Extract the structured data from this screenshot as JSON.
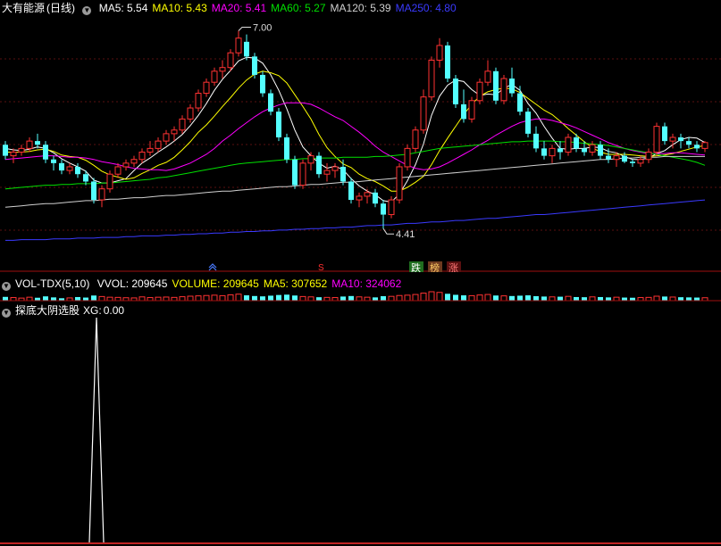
{
  "price_panel": {
    "stock_name": "大有能源",
    "period": "(日线)",
    "ma_labels": [
      {
        "label": "MA5:",
        "value": "5.54",
        "color": "#ffffff"
      },
      {
        "label": "MA10:",
        "value": "5.43",
        "color": "#ffff00"
      },
      {
        "label": "MA20:",
        "value": "5.41",
        "color": "#ff00ff"
      },
      {
        "label": "MA60:",
        "value": "5.27",
        "color": "#00e000"
      },
      {
        "label": "MA120:",
        "value": "5.39",
        "color": "#d0d0d0"
      },
      {
        "label": "MA250:",
        "value": "4.80",
        "color": "#3a3aff"
      }
    ],
    "high_marker": "7.00",
    "low_marker": "4.41",
    "event_tags": [
      {
        "text": "跌",
        "bg": "#1f6e1f",
        "color": "#ffffff"
      },
      {
        "text": "榜",
        "bg": "#6e3a1f",
        "color": "#ffcc66"
      },
      {
        "text": "涨",
        "bg": "#5a1010",
        "color": "#ff7777"
      }
    ],
    "marker_s": "S"
  },
  "volume_panel": {
    "indicator": "VOL-TDX(5,10)",
    "items": [
      {
        "label": "VVOL:",
        "value": "209645",
        "color": "#ffffff"
      },
      {
        "label": "VOLUME:",
        "value": "209645",
        "color": "#ffff00"
      },
      {
        "label": "MA5:",
        "value": "307652",
        "color": "#ffff00"
      },
      {
        "label": "MA10:",
        "value": "324062",
        "color": "#ff00ff"
      }
    ]
  },
  "signal_panel": {
    "indicator": "探底大阴选股",
    "xg_label": "XG:",
    "xg_value": "0.00"
  },
  "chart_data": {
    "type": "candlestick",
    "ylim": [
      4.0,
      7.3
    ],
    "candles": [
      [
        5.55,
        5.6,
        5.35,
        5.4
      ],
      [
        5.4,
        5.5,
        5.3,
        5.45
      ],
      [
        5.45,
        5.55,
        5.4,
        5.5
      ],
      [
        5.5,
        5.65,
        5.45,
        5.6
      ],
      [
        5.6,
        5.7,
        5.5,
        5.55
      ],
      [
        5.55,
        5.6,
        5.3,
        5.35
      ],
      [
        5.35,
        5.4,
        5.2,
        5.3
      ],
      [
        5.3,
        5.35,
        5.15,
        5.2
      ],
      [
        5.2,
        5.3,
        5.15,
        5.25
      ],
      [
        5.25,
        5.3,
        5.1,
        5.15
      ],
      [
        5.15,
        5.2,
        5.0,
        5.05
      ],
      [
        5.05,
        5.1,
        4.75,
        4.8
      ],
      [
        4.8,
        5.0,
        4.7,
        4.95
      ],
      [
        4.95,
        5.2,
        4.9,
        5.15
      ],
      [
        5.15,
        5.3,
        5.1,
        5.25
      ],
      [
        5.25,
        5.35,
        5.2,
        5.3
      ],
      [
        5.3,
        5.4,
        5.25,
        5.35
      ],
      [
        5.35,
        5.5,
        5.3,
        5.45
      ],
      [
        5.45,
        5.6,
        5.4,
        5.5
      ],
      [
        5.5,
        5.65,
        5.45,
        5.6
      ],
      [
        5.6,
        5.75,
        5.55,
        5.7
      ],
      [
        5.7,
        5.8,
        5.6,
        5.75
      ],
      [
        5.75,
        5.95,
        5.7,
        5.9
      ],
      [
        5.9,
        6.1,
        5.85,
        6.05
      ],
      [
        6.05,
        6.3,
        6.0,
        6.25
      ],
      [
        6.25,
        6.45,
        6.2,
        6.4
      ],
      [
        6.4,
        6.6,
        6.35,
        6.55
      ],
      [
        6.55,
        6.7,
        6.45,
        6.6
      ],
      [
        6.6,
        6.85,
        6.55,
        6.8
      ],
      [
        6.8,
        7.1,
        6.75,
        7.0
      ],
      [
        6.95,
        7.05,
        6.7,
        6.75
      ],
      [
        6.75,
        6.8,
        6.45,
        6.5
      ],
      [
        6.5,
        6.55,
        6.2,
        6.25
      ],
      [
        6.25,
        6.3,
        5.95,
        6.0
      ],
      [
        6.0,
        6.05,
        5.6,
        5.65
      ],
      [
        5.65,
        5.7,
        5.3,
        5.35
      ],
      [
        5.35,
        5.4,
        4.95,
        5.0
      ],
      [
        5.0,
        5.35,
        4.95,
        5.3
      ],
      [
        5.3,
        5.45,
        5.2,
        5.4
      ],
      [
        5.4,
        5.45,
        5.1,
        5.15
      ],
      [
        5.15,
        5.3,
        5.05,
        5.2
      ],
      [
        5.2,
        5.3,
        5.1,
        5.25
      ],
      [
        5.25,
        5.35,
        5.0,
        5.05
      ],
      [
        5.05,
        5.1,
        4.75,
        4.8
      ],
      [
        4.8,
        4.9,
        4.7,
        4.85
      ],
      [
        4.85,
        4.95,
        4.75,
        4.9
      ],
      [
        4.9,
        4.95,
        4.7,
        4.75
      ],
      [
        4.75,
        4.8,
        4.41,
        4.6
      ],
      [
        4.6,
        4.85,
        4.55,
        4.8
      ],
      [
        4.8,
        5.3,
        4.75,
        5.25
      ],
      [
        5.25,
        5.55,
        5.2,
        5.5
      ],
      [
        5.5,
        5.8,
        5.45,
        5.75
      ],
      [
        5.75,
        6.3,
        5.7,
        6.2
      ],
      [
        6.2,
        6.75,
        6.15,
        6.7
      ],
      [
        6.7,
        7.0,
        6.6,
        6.9
      ],
      [
        6.9,
        6.95,
        6.4,
        6.45
      ],
      [
        6.45,
        6.5,
        6.05,
        6.1
      ],
      [
        6.1,
        6.3,
        5.85,
        5.9
      ],
      [
        5.9,
        6.2,
        5.85,
        6.15
      ],
      [
        6.15,
        6.45,
        6.1,
        6.4
      ],
      [
        6.4,
        6.7,
        6.35,
        6.55
      ],
      [
        6.55,
        6.6,
        6.1,
        6.15
      ],
      [
        6.15,
        6.5,
        6.1,
        6.45
      ],
      [
        6.45,
        6.6,
        6.2,
        6.25
      ],
      [
        6.25,
        6.35,
        5.95,
        6.0
      ],
      [
        6.0,
        6.05,
        5.65,
        5.7
      ],
      [
        5.7,
        5.8,
        5.45,
        5.5
      ],
      [
        5.5,
        5.6,
        5.35,
        5.4
      ],
      [
        5.4,
        5.55,
        5.3,
        5.5
      ],
      [
        5.5,
        5.6,
        5.35,
        5.45
      ],
      [
        5.45,
        5.7,
        5.4,
        5.65
      ],
      [
        5.65,
        5.7,
        5.45,
        5.5
      ],
      [
        5.5,
        5.6,
        5.4,
        5.45
      ],
      [
        5.45,
        5.6,
        5.4,
        5.55
      ],
      [
        5.55,
        5.6,
        5.35,
        5.4
      ],
      [
        5.4,
        5.5,
        5.3,
        5.35
      ],
      [
        5.35,
        5.45,
        5.25,
        5.4
      ],
      [
        5.4,
        5.45,
        5.3,
        5.32
      ],
      [
        5.32,
        5.35,
        5.25,
        5.3
      ],
      [
        5.3,
        5.4,
        5.25,
        5.35
      ],
      [
        5.35,
        5.5,
        5.3,
        5.45
      ],
      [
        5.45,
        5.85,
        5.4,
        5.8
      ],
      [
        5.8,
        5.85,
        5.55,
        5.6
      ],
      [
        5.6,
        5.7,
        5.5,
        5.65
      ],
      [
        5.65,
        5.7,
        5.5,
        5.6
      ],
      [
        5.6,
        5.65,
        5.5,
        5.55
      ],
      [
        5.55,
        5.6,
        5.45,
        5.5
      ],
      [
        5.5,
        5.6,
        5.45,
        5.58
      ]
    ],
    "ma_series": [
      {
        "name": "MA5",
        "color": "#ffffff",
        "values": [
          5.5,
          5.48,
          5.47,
          5.49,
          5.52,
          5.5,
          5.44,
          5.36,
          5.3,
          5.25,
          5.19,
          5.07,
          5.03,
          5.03,
          5.06,
          5.09,
          5.2,
          5.3,
          5.37,
          5.45,
          5.52,
          5.6,
          5.69,
          5.81,
          5.95,
          6.11,
          6.29,
          6.44,
          6.56,
          6.69,
          6.74,
          6.73,
          6.66,
          6.5,
          6.29,
          6.04,
          5.75,
          5.52,
          5.4,
          5.3,
          5.23,
          5.26,
          5.21,
          5.09,
          4.99,
          4.92,
          4.87,
          4.79,
          4.77,
          4.88,
          5.06,
          5.28,
          5.56,
          5.95,
          6.21,
          6.36,
          6.43,
          6.41,
          6.3,
          6.22,
          6.24,
          6.23,
          6.32,
          6.37,
          6.29,
          6.11,
          5.98,
          5.8,
          5.64,
          5.5,
          5.49,
          5.5,
          5.5,
          5.52,
          5.51,
          5.46,
          5.44,
          5.39,
          5.35,
          5.35,
          5.37,
          5.43,
          5.47,
          5.55,
          5.62,
          5.65,
          5.64,
          5.58
        ]
      },
      {
        "name": "MA10",
        "color": "#ffff00",
        "values": [
          5.45,
          5.45,
          5.45,
          5.46,
          5.48,
          5.49,
          5.46,
          5.41,
          5.39,
          5.38,
          5.34,
          5.27,
          5.19,
          5.14,
          5.11,
          5.08,
          5.1,
          5.16,
          5.21,
          5.27,
          5.31,
          5.38,
          5.48,
          5.59,
          5.72,
          5.82,
          5.94,
          6.07,
          6.19,
          6.32,
          6.43,
          6.51,
          6.55,
          6.53,
          6.49,
          6.39,
          6.23,
          6.07,
          5.9,
          5.69,
          5.51,
          5.39,
          5.29,
          5.24,
          5.15,
          5.09,
          5.05,
          4.99,
          4.92,
          4.92,
          4.97,
          5.04,
          5.12,
          5.28,
          5.47,
          5.64,
          5.8,
          5.96,
          6.1,
          6.21,
          6.27,
          6.3,
          6.32,
          6.31,
          6.26,
          6.18,
          6.1,
          6.02,
          5.96,
          5.87,
          5.77,
          5.68,
          5.59,
          5.51,
          5.45,
          5.42,
          5.42,
          5.42,
          5.41,
          5.4,
          5.39,
          5.4,
          5.41,
          5.43,
          5.46,
          5.49,
          5.52,
          5.54
        ]
      },
      {
        "name": "MA20",
        "color": "#ff00ff",
        "values": [
          5.35,
          5.36,
          5.37,
          5.38,
          5.39,
          5.4,
          5.4,
          5.39,
          5.38,
          5.38,
          5.37,
          5.35,
          5.32,
          5.3,
          5.28,
          5.25,
          5.23,
          5.22,
          5.21,
          5.21,
          5.2,
          5.22,
          5.26,
          5.3,
          5.36,
          5.42,
          5.5,
          5.6,
          5.68,
          5.77,
          5.85,
          5.93,
          6.0,
          6.05,
          6.09,
          6.12,
          6.12,
          6.12,
          6.1,
          6.05,
          5.99,
          5.93,
          5.88,
          5.8,
          5.72,
          5.63,
          5.53,
          5.45,
          5.39,
          5.33,
          5.27,
          5.23,
          5.21,
          5.22,
          5.25,
          5.3,
          5.36,
          5.42,
          5.48,
          5.55,
          5.61,
          5.68,
          5.74,
          5.8,
          5.85,
          5.88,
          5.9,
          5.9,
          5.88,
          5.85,
          5.82,
          5.78,
          5.73,
          5.68,
          5.63,
          5.58,
          5.54,
          5.5,
          5.47,
          5.45,
          5.43,
          5.43,
          5.43,
          5.44,
          5.44,
          5.43,
          5.42,
          5.41
        ]
      },
      {
        "name": "MA60",
        "color": "#00e000",
        "values": [
          4.95,
          4.96,
          4.97,
          4.98,
          4.99,
          5.0,
          5.0,
          5.01,
          5.01,
          5.02,
          5.02,
          5.02,
          5.03,
          5.03,
          5.04,
          5.05,
          5.06,
          5.07,
          5.08,
          5.1,
          5.11,
          5.13,
          5.15,
          5.17,
          5.19,
          5.21,
          5.23,
          5.25,
          5.27,
          5.29,
          5.3,
          5.31,
          5.32,
          5.33,
          5.34,
          5.35,
          5.35,
          5.36,
          5.36,
          5.37,
          5.37,
          5.37,
          5.38,
          5.38,
          5.38,
          5.38,
          5.39,
          5.39,
          5.4,
          5.41,
          5.42,
          5.44,
          5.46,
          5.48,
          5.5,
          5.51,
          5.52,
          5.53,
          5.54,
          5.55,
          5.56,
          5.57,
          5.58,
          5.59,
          5.59,
          5.6,
          5.6,
          5.6,
          5.6,
          5.59,
          5.59,
          5.58,
          5.57,
          5.56,
          5.55,
          5.54,
          5.52,
          5.5,
          5.48,
          5.46,
          5.44,
          5.42,
          5.4,
          5.38,
          5.36,
          5.34,
          5.31,
          5.27
        ]
      },
      {
        "name": "MA120",
        "color": "#d0d0d0",
        "values": [
          4.7,
          4.71,
          4.72,
          4.73,
          4.74,
          4.75,
          4.75,
          4.76,
          4.77,
          4.78,
          4.79,
          4.79,
          4.8,
          4.81,
          4.81,
          4.82,
          4.83,
          4.83,
          4.84,
          4.85,
          4.86,
          4.86,
          4.87,
          4.88,
          4.89,
          4.9,
          4.91,
          4.92,
          4.92,
          4.93,
          4.94,
          4.95,
          4.96,
          4.97,
          4.98,
          4.98,
          4.99,
          5.0,
          5.01,
          5.01,
          5.02,
          5.03,
          5.04,
          5.04,
          5.05,
          5.06,
          5.07,
          5.08,
          5.09,
          5.1,
          5.11,
          5.12,
          5.13,
          5.14,
          5.15,
          5.16,
          5.17,
          5.18,
          5.19,
          5.2,
          5.21,
          5.22,
          5.23,
          5.24,
          5.25,
          5.26,
          5.27,
          5.28,
          5.29,
          5.3,
          5.31,
          5.32,
          5.33,
          5.34,
          5.35,
          5.35,
          5.36,
          5.37,
          5.37,
          5.38,
          5.38,
          5.38,
          5.39,
          5.39,
          5.39,
          5.39,
          5.39,
          5.39
        ]
      },
      {
        "name": "MA250",
        "color": "#3a3aff",
        "values": [
          4.25,
          4.25,
          4.26,
          4.26,
          4.26,
          4.26,
          4.27,
          4.27,
          4.27,
          4.28,
          4.28,
          4.28,
          4.29,
          4.29,
          4.29,
          4.3,
          4.3,
          4.31,
          4.31,
          4.31,
          4.32,
          4.32,
          4.33,
          4.33,
          4.34,
          4.34,
          4.35,
          4.35,
          4.36,
          4.36,
          4.37,
          4.37,
          4.38,
          4.38,
          4.39,
          4.39,
          4.4,
          4.4,
          4.41,
          4.41,
          4.42,
          4.42,
          4.43,
          4.43,
          4.44,
          4.45,
          4.45,
          4.46,
          4.46,
          4.47,
          4.48,
          4.48,
          4.49,
          4.5,
          4.5,
          4.51,
          4.52,
          4.52,
          4.53,
          4.54,
          4.55,
          4.55,
          4.56,
          4.57,
          4.58,
          4.59,
          4.6,
          4.6,
          4.61,
          4.62,
          4.63,
          4.64,
          4.65,
          4.66,
          4.67,
          4.68,
          4.69,
          4.7,
          4.71,
          4.72,
          4.73,
          4.74,
          4.75,
          4.76,
          4.77,
          4.78,
          4.79,
          4.8
        ]
      }
    ],
    "volume": [
      22,
      18,
      15,
      20,
      17,
      25,
      19,
      14,
      16,
      21,
      18,
      30,
      24,
      20,
      19,
      17,
      16,
      22,
      18,
      20,
      21,
      19,
      23,
      26,
      28,
      30,
      32,
      29,
      34,
      38,
      31,
      27,
      25,
      29,
      33,
      35,
      30,
      24,
      22,
      20,
      19,
      18,
      24,
      27,
      22,
      20,
      19,
      26,
      25,
      30,
      32,
      36,
      44,
      52,
      48,
      40,
      34,
      31,
      29,
      33,
      36,
      30,
      28,
      27,
      29,
      31,
      26,
      24,
      22,
      23,
      25,
      21,
      20,
      22,
      21,
      19,
      20,
      18,
      17,
      18,
      19,
      26,
      24,
      21,
      20,
      19,
      18,
      17
    ],
    "signal_x_index": 11,
    "signal_value": 1
  }
}
